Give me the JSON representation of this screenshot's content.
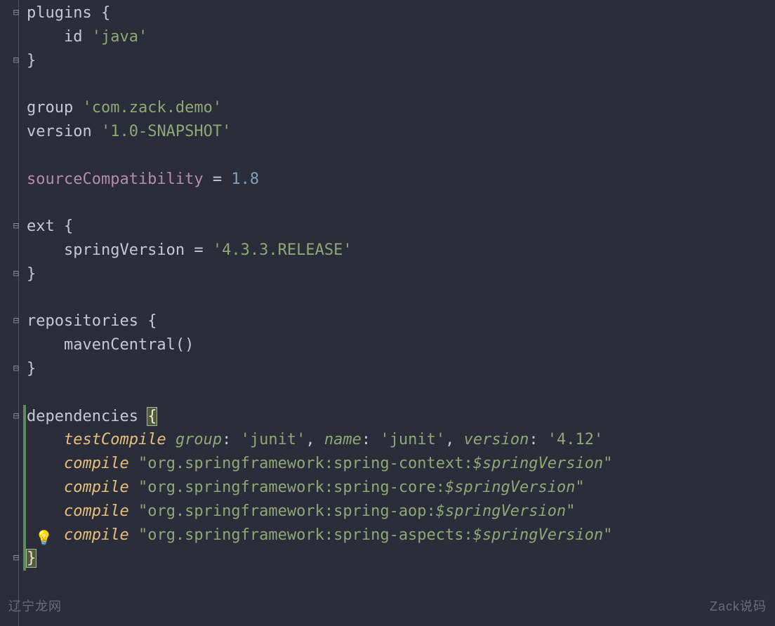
{
  "code": {
    "lines": [
      {
        "fold": "open",
        "segments": [
          [
            "plain",
            "plugins "
          ],
          [
            "brace",
            "{"
          ]
        ]
      },
      {
        "fold": null,
        "segments": [
          [
            "plain",
            "    id "
          ],
          [
            "str",
            "'java'"
          ]
        ]
      },
      {
        "fold": "close",
        "segments": [
          [
            "brace",
            "}"
          ]
        ]
      },
      {
        "fold": null,
        "segments": []
      },
      {
        "fold": null,
        "segments": [
          [
            "plain",
            "group "
          ],
          [
            "str",
            "'com.zack.demo'"
          ]
        ]
      },
      {
        "fold": null,
        "segments": [
          [
            "plain",
            "version "
          ],
          [
            "str",
            "'1.0-SNAPSHOT'"
          ]
        ]
      },
      {
        "fold": null,
        "segments": []
      },
      {
        "fold": null,
        "segments": [
          [
            "prop",
            "sourceCompatibility"
          ],
          [
            "plain",
            " = "
          ],
          [
            "num",
            "1.8"
          ]
        ]
      },
      {
        "fold": null,
        "segments": []
      },
      {
        "fold": "open",
        "segments": [
          [
            "plain",
            "ext "
          ],
          [
            "brace",
            "{"
          ]
        ]
      },
      {
        "fold": null,
        "segments": [
          [
            "plain",
            "    springVersion = "
          ],
          [
            "str",
            "'4.3.3.RELEASE'"
          ]
        ]
      },
      {
        "fold": "close",
        "segments": [
          [
            "brace",
            "}"
          ]
        ]
      },
      {
        "fold": null,
        "segments": []
      },
      {
        "fold": "open",
        "segments": [
          [
            "plain",
            "repositories "
          ],
          [
            "brace",
            "{"
          ]
        ]
      },
      {
        "fold": null,
        "segments": [
          [
            "plain",
            "    mavenCentral()"
          ]
        ]
      },
      {
        "fold": "close",
        "segments": [
          [
            "brace",
            "}"
          ]
        ]
      },
      {
        "fold": null,
        "segments": []
      },
      {
        "fold": "open",
        "caret": true,
        "segments": [
          [
            "plain",
            "dependencies "
          ],
          [
            "braceHi",
            "{"
          ]
        ]
      },
      {
        "fold": null,
        "caret": true,
        "segments": [
          [
            "plain",
            "    "
          ],
          [
            "callY",
            "testCompile"
          ],
          [
            "plain",
            " "
          ],
          [
            "param",
            "group"
          ],
          [
            "plain",
            ": "
          ],
          [
            "str",
            "'junit'"
          ],
          [
            "plain",
            ", "
          ],
          [
            "param",
            "name"
          ],
          [
            "plain",
            ": "
          ],
          [
            "str",
            "'junit'"
          ],
          [
            "plain",
            ", "
          ],
          [
            "param",
            "version"
          ],
          [
            "plain",
            ": "
          ],
          [
            "str",
            "'4.12'"
          ]
        ]
      },
      {
        "fold": null,
        "caret": true,
        "segments": [
          [
            "plain",
            "    "
          ],
          [
            "callY",
            "compile"
          ],
          [
            "plain",
            " "
          ],
          [
            "str",
            "\"org.springframework:spring-context:"
          ],
          [
            "strI",
            "$springVersion"
          ],
          [
            "str",
            "\""
          ]
        ]
      },
      {
        "fold": null,
        "caret": true,
        "segments": [
          [
            "plain",
            "    "
          ],
          [
            "callY",
            "compile"
          ],
          [
            "plain",
            " "
          ],
          [
            "str",
            "\"org.springframework:spring-core:"
          ],
          [
            "strI",
            "$springVersion"
          ],
          [
            "str",
            "\""
          ]
        ]
      },
      {
        "fold": null,
        "caret": true,
        "segments": [
          [
            "plain",
            "    "
          ],
          [
            "callY",
            "compile"
          ],
          [
            "plain",
            " "
          ],
          [
            "str",
            "\"org.springframework:spring-aop:"
          ],
          [
            "strI",
            "$springVersion"
          ],
          [
            "str",
            "\""
          ]
        ]
      },
      {
        "fold": null,
        "caret": true,
        "bulb": true,
        "segments": [
          [
            "plain",
            "    "
          ],
          [
            "callY",
            "compile"
          ],
          [
            "plain",
            " "
          ],
          [
            "str",
            "\"org.springframework:spring-aspects:"
          ],
          [
            "strI",
            "$springVersion"
          ],
          [
            "str",
            "\""
          ]
        ]
      },
      {
        "fold": "close",
        "caret": true,
        "segments": [
          [
            "braceHi",
            "}"
          ]
        ]
      }
    ]
  },
  "icons": {
    "bulb": "💡"
  },
  "colors": {
    "background": "#2b2d3a",
    "keyword": "#a3be8c",
    "string": "#8fa876",
    "number": "#81a1c1",
    "property": "#b48ead",
    "highlightBrace": "#4f5b3a"
  },
  "watermarks": {
    "left": "辽宁龙网",
    "right": "Zack说码"
  }
}
